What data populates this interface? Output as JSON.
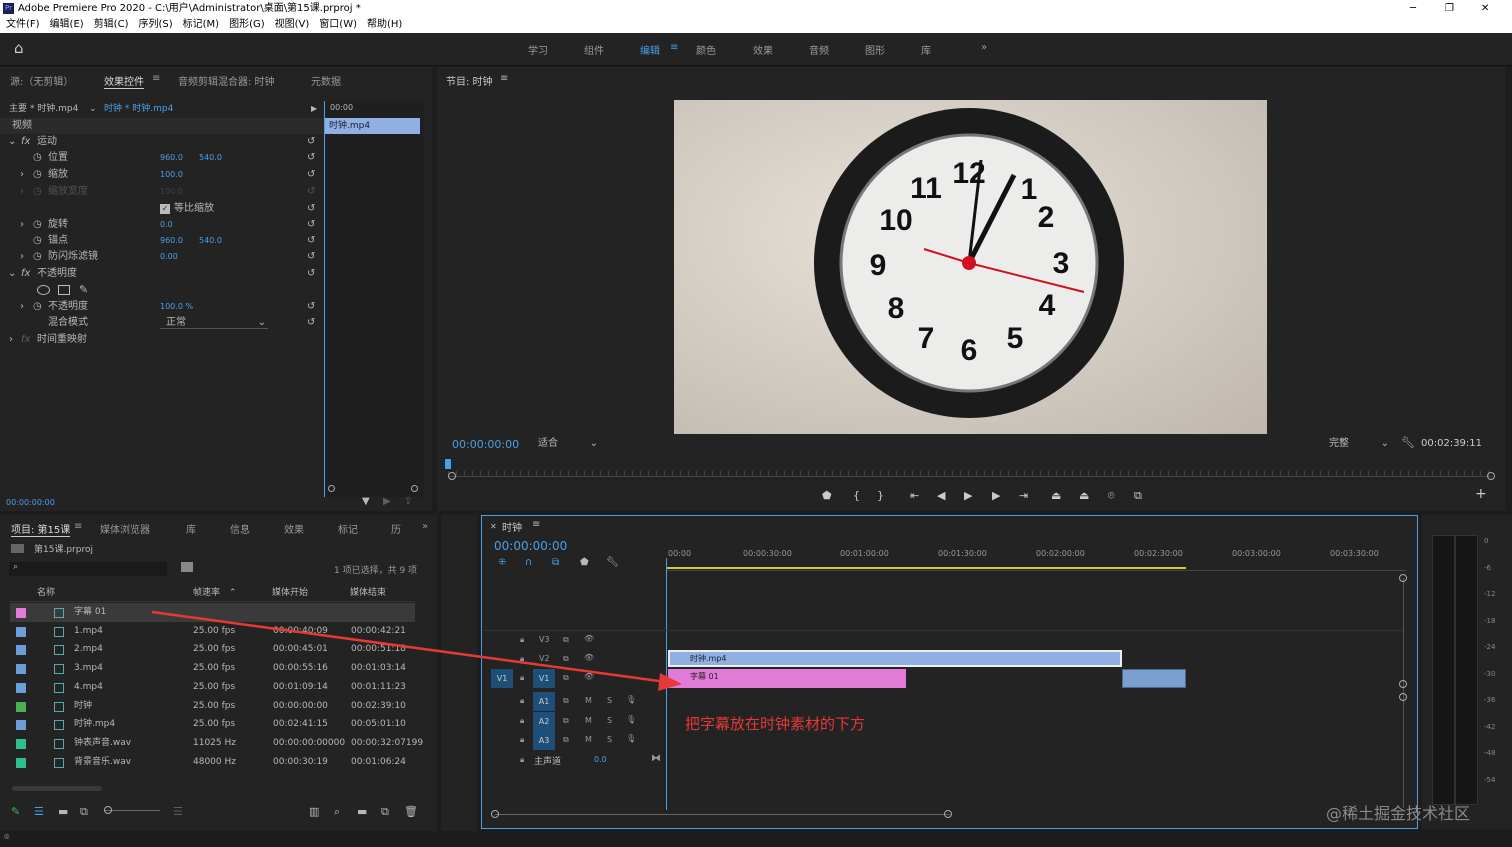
{
  "app": {
    "title": "Adobe Premiere Pro 2020 - C:\\用户\\Administrator\\桌面\\第15课.prproj *"
  },
  "menu": [
    "文件(F)",
    "编辑(E)",
    "剪辑(C)",
    "序列(S)",
    "标记(M)",
    "图形(G)",
    "视图(V)",
    "窗口(W)",
    "帮助(H)"
  ],
  "workspaces": [
    "学习",
    "组件",
    "编辑",
    "颜色",
    "效果",
    "音频",
    "图形",
    "库"
  ],
  "effects_panel": {
    "tabs": [
      "源:（无剪辑）",
      "效果控件",
      "音频剪辑混合器: 时钟",
      "元数据"
    ],
    "master": "主要 * 时钟.mp4",
    "sequence_clip": "时钟 * 时钟.mp4",
    "section_video": "视频",
    "motion": "运动",
    "position": {
      "label": "位置",
      "x": "960.0",
      "y": "540.0"
    },
    "scale": {
      "label": "缩放",
      "value": "100.0"
    },
    "scale_width": {
      "label": "缩放宽度",
      "value": "100.0"
    },
    "uniform_scale": "等比缩放",
    "rotation": {
      "label": "旋转",
      "value": "0.0"
    },
    "anchor": {
      "label": "锚点",
      "x": "960.0",
      "y": "540.0"
    },
    "antiflicker": {
      "label": "防闪烁滤镜",
      "value": "0.00"
    },
    "opacity_section": "不透明度",
    "opacity": {
      "label": "不透明度",
      "value": "100.0 %"
    },
    "blend": {
      "label": "混合模式",
      "value": "正常"
    },
    "time_remap": "时间重映射",
    "mini_time": "00:00",
    "mini_clip": "时钟.mp4",
    "timecode": "00:00:00:00"
  },
  "program": {
    "title": "节目: 时钟",
    "timecode": "00:00:00:00",
    "fit": "适合",
    "quality": "完整",
    "duration": "00:02:39:11"
  },
  "project": {
    "tabs": [
      "项目: 第15课",
      "媒体浏览器",
      "库",
      "信息",
      "效果",
      "标记",
      "历"
    ],
    "file": "第15课.prproj",
    "count": "1 项已选择，共 9 项",
    "columns": [
      "名称",
      "帧速率",
      "媒体开始",
      "媒体结束"
    ],
    "items": [
      {
        "name": "字幕 01",
        "fps": "",
        "start": "",
        "end": "",
        "color": "#e27ad8"
      },
      {
        "name": "1.mp4",
        "fps": "25.00 fps",
        "start": "00:00:40:09",
        "end": "00:00:42:21",
        "color": "#6a9ed8"
      },
      {
        "name": "2.mp4",
        "fps": "25.00 fps",
        "start": "00:00:45:01",
        "end": "00:00:51:18",
        "color": "#6a9ed8"
      },
      {
        "name": "3.mp4",
        "fps": "25.00 fps",
        "start": "00:00:55:16",
        "end": "00:01:03:14",
        "color": "#6a9ed8"
      },
      {
        "name": "4.mp4",
        "fps": "25.00 fps",
        "start": "00:01:09:14",
        "end": "00:01:11:23",
        "color": "#6a9ed8"
      },
      {
        "name": "时钟",
        "fps": "25.00 fps",
        "start": "00:00:00:00",
        "end": "00:02:39:10",
        "color": "#4caf50"
      },
      {
        "name": "时钟.mp4",
        "fps": "25.00 fps",
        "start": "00:02:41:15",
        "end": "00:05:01:10",
        "color": "#6a9ed8"
      },
      {
        "name": "钟表声音.wav",
        "fps": "11025 Hz",
        "start": "00:00:00:00000",
        "end": "00:00:32:07199",
        "color": "#2fbf8a"
      },
      {
        "name": "背景音乐.wav",
        "fps": "48000 Hz",
        "start": "00:00:30:19",
        "end": "00:01:06:24",
        "color": "#2fbf8a"
      }
    ]
  },
  "timeline": {
    "title": "时钟",
    "timecode": "00:00:00:00",
    "ruler": [
      "00:00",
      "00:00:30:00",
      "00:01:00:00",
      "00:01:30:00",
      "00:02:00:00",
      "00:02:30:00",
      "00:03:00:00",
      "00:03:30:00"
    ],
    "tracks": [
      "V3",
      "V2",
      "V1",
      "A1",
      "A2",
      "A3"
    ],
    "source_v1": "V1",
    "master": "主声道",
    "master_val": "0.0",
    "clip_v2": "时钟.mp4",
    "clip_v1": "字幕 01",
    "annotation": "把字幕放在时钟素材的下方",
    "m_label": "M",
    "s_label": "S"
  },
  "meters": [
    "0",
    "-6",
    "-12",
    "-18",
    "-24",
    "-30",
    "-36",
    "-42",
    "-48",
    "-54"
  ],
  "watermark": "@稀土掘金技术社区",
  "colors": {
    "accent": "#4a9fe8",
    "clip_video": "#8fb0e0",
    "clip_title": "#e27ad8",
    "arrow": "#e53935"
  }
}
